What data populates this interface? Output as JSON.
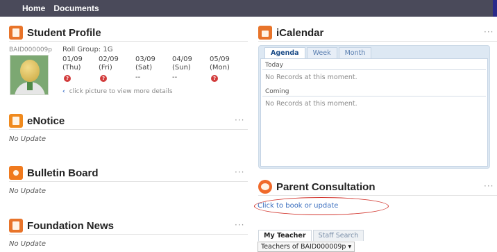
{
  "nav": {
    "items": [
      "Home",
      "Documents"
    ]
  },
  "student_profile": {
    "title": "Student Profile",
    "student_id": "BAID000009p",
    "roll_group": "Roll Group: 1G",
    "attendance": [
      {
        "date": "01/09",
        "day": "(Thu)",
        "status": "icon"
      },
      {
        "date": "02/09",
        "day": "(Fri)",
        "status": "icon"
      },
      {
        "date": "03/09",
        "day": "(Sat)",
        "status": "--"
      },
      {
        "date": "04/09",
        "day": "(Sun)",
        "status": "--"
      },
      {
        "date": "05/09",
        "day": "(Mon)",
        "status": "icon"
      }
    ],
    "hint": "click picture to view more details"
  },
  "enotice": {
    "title": "eNotice",
    "more": "···",
    "text": "No Update"
  },
  "bulletin": {
    "title": "Bulletin Board",
    "more": "···",
    "text": "No Update"
  },
  "foundation": {
    "title": "Foundation News",
    "more": "···",
    "text": "No Update"
  },
  "icalendar": {
    "title": "iCalendar",
    "more": "···",
    "tabs": [
      "Agenda",
      "Week",
      "Month"
    ],
    "sections": [
      {
        "label": "Today",
        "text": "No Records at this moment."
      },
      {
        "label": "Coming",
        "text": "No Records at this moment."
      }
    ]
  },
  "consultation": {
    "title": "Parent Consultation",
    "more": "···",
    "link": "Click to book or update",
    "tabs": [
      "My Teacher",
      "Staff Search"
    ],
    "select_value": "Teachers of BAID000009p ▾"
  },
  "colors": {
    "topbar": "#4a4a5a",
    "accent_orange": "#e8742a",
    "link": "#3b6fbf",
    "highlight": "#d2342c"
  }
}
